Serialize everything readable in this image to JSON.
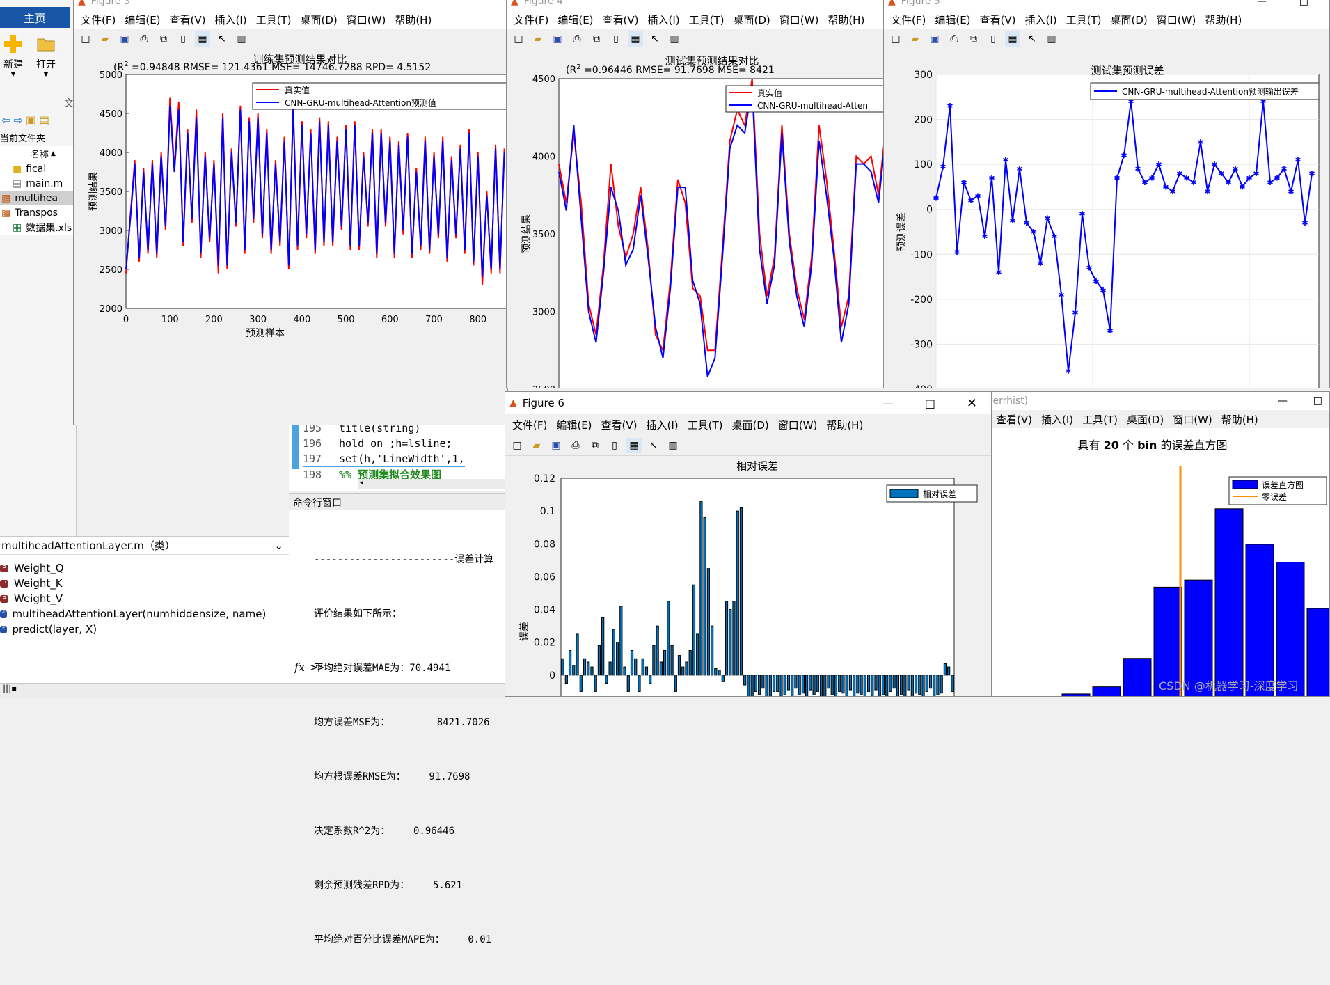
{
  "left_panel": {
    "home_tab": "主页",
    "new_label": "新建",
    "open_label": "打开",
    "current_folder_label": "当前文件夹",
    "name_column": "名称",
    "files": [
      "fical",
      "main.m",
      "multihea",
      "Transpos",
      "数据集.xls"
    ],
    "class_header": "multiheadAttentionLayer.m（类）",
    "members": [
      "Weight_Q",
      "Weight_K",
      "Weight_V",
      "multiheadAttentionLayer(numhiddensize, name)",
      "predict(layer, X)"
    ],
    "wen": "文"
  },
  "menu": [
    "文件(F)",
    "编辑(E)",
    "查看(V)",
    "插入(I)",
    "工具(T)",
    "桌面(D)",
    "窗口(W)",
    "帮助(H)"
  ],
  "editor": {
    "lines": [
      {
        "num": "195",
        "code": "title(string)"
      },
      {
        "num": "196",
        "code": "hold on ;h=lsline;"
      },
      {
        "num": "197",
        "code": "set(h,'LineWidth',1,"
      },
      {
        "num": "198",
        "code": "%% 预测集拟合效果图"
      }
    ]
  },
  "command": {
    "title": "命令行窗口",
    "lines": [
      "------------------------误差计算",
      "评价结果如下所示：",
      "平均绝对误差MAE为：70.4941",
      "均方误差MSE为：        8421.7026",
      "均方根误差RMSE为：    91.7698",
      "决定系数R^2为：    0.96446",
      "剩余预测残差RPD为：    5.621",
      "平均绝对百分比误差MAPE为：    0.01"
    ],
    "fx": "fx",
    "prompt": ">>"
  },
  "figure3": {
    "title": "Figure 3",
    "chart_title": "训练集预测结果对比",
    "subtitle_pre": "(R",
    "subtitle_sup": "2",
    "subtitle_post": " =0.94848 RMSE= 121.4361 MSE= 14746.7288 RPD= 4.5152",
    "xlabel": "预测样本",
    "ylabel": "预测结果",
    "legend": [
      "真实值",
      "CNN-GRU-multihead-Attention预测值"
    ],
    "xticks": [
      "0",
      "100",
      "200",
      "300",
      "400",
      "500",
      "600",
      "700",
      "800"
    ],
    "yticks": [
      "2000",
      "2500",
      "3000",
      "3500",
      "4000",
      "4500",
      "5000"
    ]
  },
  "figure4": {
    "title": "Figure 4",
    "chart_title": "测试集预测结果对比",
    "subtitle_pre": "(R",
    "subtitle_sup": "2",
    "subtitle_post": " =0.96446 RMSE= 91.7698 MSE= 8421",
    "ylabel": "预测结果",
    "legend": [
      "真实值",
      "CNN-GRU-multihead-Atten"
    ],
    "yticks": [
      "2500",
      "3000",
      "3500",
      "4000",
      "4500"
    ]
  },
  "figure5": {
    "title": "Figure 5",
    "chart_title": "测试集预测误差",
    "ylabel": "预测误差",
    "legend": [
      "CNN-GRU-multihead-Attention预测输出误差"
    ],
    "yticks": [
      "-400",
      "-300",
      "-200",
      "-100",
      "0",
      "100",
      "200",
      "300"
    ]
  },
  "figure6": {
    "title": "Figure 6",
    "chart_title": "相对误差",
    "ylabel": "误差",
    "legend": [
      "相对误差"
    ],
    "yticks": [
      "0.12",
      "0.1",
      "0.08",
      "0.06",
      "0.04",
      "0.02",
      "0",
      "-0.02"
    ]
  },
  "errhist": {
    "title": "errhist)",
    "title_prefix": "terrhist)",
    "chart_title_pre": "具有 ",
    "chart_title_bold": "20",
    "chart_title_mid": " 个 ",
    "chart_title_bold2": "bin",
    "chart_title_post": " 的误差直方图",
    "legend": [
      "误差直方图",
      "零误差"
    ]
  },
  "watermark": "CSDN @机器学习-深度学习",
  "colors": {
    "red": "#ff0000",
    "blue": "#0000ff",
    "bar": "#0072bd",
    "orange": "#ff8c00"
  },
  "chart_data": [
    {
      "type": "line",
      "title": "训练集预测结果对比",
      "xlabel": "预测样本",
      "ylabel": "预测结果",
      "xlim": [
        0,
        870
      ],
      "ylim": [
        2000,
        5000
      ],
      "series": [
        {
          "name": "真实值"
        },
        {
          "name": "CNN-GRU-multihead-Attention预测值"
        }
      ],
      "x": [
        0,
        10,
        20,
        30,
        40,
        50,
        60,
        70,
        80,
        90,
        100,
        110,
        120,
        130,
        140,
        150,
        160,
        170,
        180,
        190,
        200,
        210,
        220,
        230,
        240,
        250,
        260,
        270,
        280,
        290,
        300,
        310,
        320,
        330,
        340,
        350,
        360,
        370,
        380,
        390,
        400,
        410,
        420,
        430,
        440,
        450,
        460,
        470,
        480,
        490,
        500,
        510,
        520,
        530,
        540,
        550,
        560,
        570,
        580,
        590,
        600,
        610,
        620,
        630,
        640,
        650,
        660,
        670,
        680,
        690,
        700,
        710,
        720,
        730,
        740,
        750,
        760,
        770,
        780,
        790,
        800,
        810,
        820,
        830,
        840,
        850,
        860
      ],
      "true": [
        2450,
        3200,
        3900,
        2600,
        3800,
        2700,
        3900,
        2650,
        4000,
        3000,
        4700,
        3800,
        4650,
        2800,
        4300,
        3100,
        4550,
        2650,
        4000,
        2850,
        3900,
        2450,
        4500,
        2500,
        4050,
        3050,
        4600,
        2700,
        4450,
        3100,
        4500,
        2900,
        4300,
        2700,
        3900,
        2800,
        4200,
        2500,
        4600,
        2750,
        4400,
        2900,
        4300,
        2700,
        4450,
        2800,
        4400,
        2800,
        4200,
        3000,
        4350,
        2750,
        4400,
        2750,
        4000,
        3050,
        4300,
        2650,
        4300,
        3050,
        4200,
        2650,
        4150,
        2950,
        4250,
        2650,
        3800,
        2750,
        4200,
        2700,
        4000,
        2900,
        4200,
        2600,
        3950,
        2900,
        4100,
        2700,
        4300,
        2550,
        4000,
        2300,
        3500,
        2450,
        4100,
        2450,
        4050
      ],
      "pred": [
        2500,
        3150,
        3850,
        2650,
        3750,
        2750,
        3850,
        2700,
        3950,
        3050,
        4600,
        3750,
        4550,
        2850,
        4250,
        3150,
        4450,
        2700,
        3950,
        2900,
        3850,
        2550,
        4450,
        2550,
        4000,
        3100,
        4550,
        2750,
        4400,
        3150,
        4450,
        2950,
        4250,
        2750,
        3850,
        2850,
        4150,
        2550,
        4550,
        2800,
        4350,
        2950,
        4250,
        2750,
        4400,
        2850,
        4350,
        2850,
        4150,
        3050,
        4300,
        2800,
        4350,
        2800,
        3950,
        3100,
        4250,
        2700,
        4250,
        3100,
        4150,
        2700,
        4100,
        3000,
        4200,
        2700,
        3750,
        2800,
        4150,
        2750,
        3950,
        2950,
        4150,
        2650,
        3900,
        2950,
        4050,
        2750,
        4250,
        2600,
        3950,
        2400,
        3450,
        2500,
        4050,
        2500,
        4000
      ]
    },
    {
      "type": "line",
      "title": "测试集预测结果对比",
      "ylabel": "预测结果",
      "xlim": [
        0,
        220
      ],
      "ylim": [
        2500,
        4500
      ],
      "series": [
        {
          "name": "真实值"
        },
        {
          "name": "CNN-GRU-multihead-Atten"
        }
      ],
      "x": [
        0,
        5,
        10,
        15,
        20,
        25,
        30,
        35,
        40,
        45,
        50,
        55,
        60,
        65,
        70,
        75,
        80,
        85,
        90,
        95,
        100,
        105,
        110,
        115,
        120,
        125,
        130,
        135,
        140,
        145,
        150,
        155,
        160,
        165,
        170,
        175,
        180,
        185,
        190,
        195,
        200,
        205,
        210,
        215,
        220
      ],
      "true": [
        3950,
        3700,
        4150,
        3700,
        3050,
        2850,
        3300,
        3950,
        3550,
        3350,
        3500,
        3800,
        3400,
        2850,
        2750,
        3200,
        3850,
        3700,
        3150,
        3100,
        2750,
        2750,
        3400,
        4100,
        4300,
        4200,
        4500,
        3500,
        3100,
        3350,
        4200,
        3500,
        3150,
        2950,
        3350,
        4200,
        3850,
        3400,
        2900,
        3100,
        4000,
        3950,
        4000,
        3750,
        4200
      ],
      "pred": [
        3900,
        3650,
        4200,
        3600,
        3000,
        2800,
        3250,
        3800,
        3650,
        3300,
        3400,
        3750,
        3350,
        2900,
        2700,
        3150,
        3800,
        3800,
        3200,
        3050,
        2580,
        2700,
        3350,
        4050,
        4200,
        4150,
        4450,
        3400,
        3050,
        3300,
        4150,
        3450,
        3100,
        2900,
        3300,
        4100,
        3750,
        3350,
        2800,
        3050,
        3950,
        3950,
        3900,
        3700,
        4150
      ]
    },
    {
      "type": "line",
      "title": "测试集预测误差",
      "ylabel": "预测误差",
      "xlim": [
        0,
        220
      ],
      "ylim": [
        -400,
        300
      ],
      "series": [
        {
          "name": "CNN-GRU-multihead-Attention预测输出误差"
        }
      ],
      "x": [
        0,
        4,
        8,
        12,
        16,
        20,
        24,
        28,
        32,
        36,
        40,
        44,
        48,
        52,
        56,
        60,
        64,
        68,
        72,
        76,
        80,
        84,
        88,
        92,
        96,
        100,
        104,
        108,
        112,
        116,
        120,
        124,
        128,
        132,
        136,
        140,
        144,
        148,
        152,
        156,
        160,
        164,
        168,
        172,
        176,
        180,
        184,
        188,
        192,
        196,
        200,
        204,
        208,
        212,
        216
      ],
      "values": [
        25,
        95,
        230,
        -95,
        60,
        20,
        30,
        -60,
        70,
        -140,
        110,
        -25,
        90,
        -30,
        -50,
        -120,
        -20,
        -60,
        -190,
        -360,
        -230,
        -10,
        -130,
        -160,
        -180,
        -270,
        70,
        120,
        240,
        90,
        60,
        70,
        100,
        50,
        40,
        80,
        70,
        60,
        150,
        40,
        100,
        80,
        60,
        90,
        50,
        70,
        80,
        240,
        60,
        70,
        90,
        40,
        110,
        -30,
        80
      ]
    },
    {
      "type": "bar",
      "title": "相对误差",
      "ylabel": "误差",
      "ylim": [
        -0.02,
        0.12
      ],
      "series": [
        {
          "name": "相对误差"
        }
      ],
      "values": [
        0.01,
        -0.005,
        0.015,
        0.006,
        0.025,
        -0.01,
        0.01,
        0.008,
        0.005,
        -0.01,
        0.018,
        0.035,
        -0.005,
        0.008,
        0.028,
        0.02,
        0.042,
        0.005,
        -0.01,
        0.015,
        0.01,
        -0.01,
        0.01,
        0.005,
        -0.005,
        0.018,
        0.03,
        0.008,
        0.015,
        0.045,
        0.018,
        -0.01,
        0.012,
        0.005,
        0.008,
        0.015,
        0.055,
        0.025,
        0.106,
        0.096,
        0.065,
        0.03,
        0.004,
        0.003,
        -0.004,
        0.045,
        0.04,
        0.045,
        0.1,
        0.102,
        -0.006,
        -0.018,
        -0.015,
        -0.01,
        -0.012,
        -0.008,
        -0.015,
        -0.016,
        -0.01,
        -0.01,
        -0.014,
        -0.012,
        -0.009,
        -0.015,
        -0.008,
        -0.012,
        -0.011,
        -0.014,
        -0.009,
        -0.012,
        -0.01,
        -0.016,
        -0.014,
        -0.008,
        -0.012,
        -0.015,
        -0.01,
        -0.011,
        -0.013,
        -0.009,
        -0.014,
        -0.011,
        -0.012,
        -0.015,
        -0.01,
        -0.013,
        -0.009,
        -0.014,
        -0.012,
        -0.016,
        -0.01,
        -0.008,
        -0.014,
        -0.012,
        -0.013,
        -0.009,
        -0.015,
        -0.011,
        -0.012,
        -0.014,
        -0.01,
        -0.008,
        -0.013,
        -0.012,
        -0.011,
        0.007,
        0.005,
        -0.01
      ]
    },
    {
      "type": "bar",
      "title": "具有 20 个 bin 的误差直方图",
      "series": [
        {
          "name": "误差直方图"
        },
        {
          "name": "零误差"
        }
      ],
      "values": [
        0.005,
        0.015,
        0.055,
        0.155,
        0.165,
        0.265,
        0.215,
        0.19,
        0.125,
        0.045
      ]
    }
  ]
}
